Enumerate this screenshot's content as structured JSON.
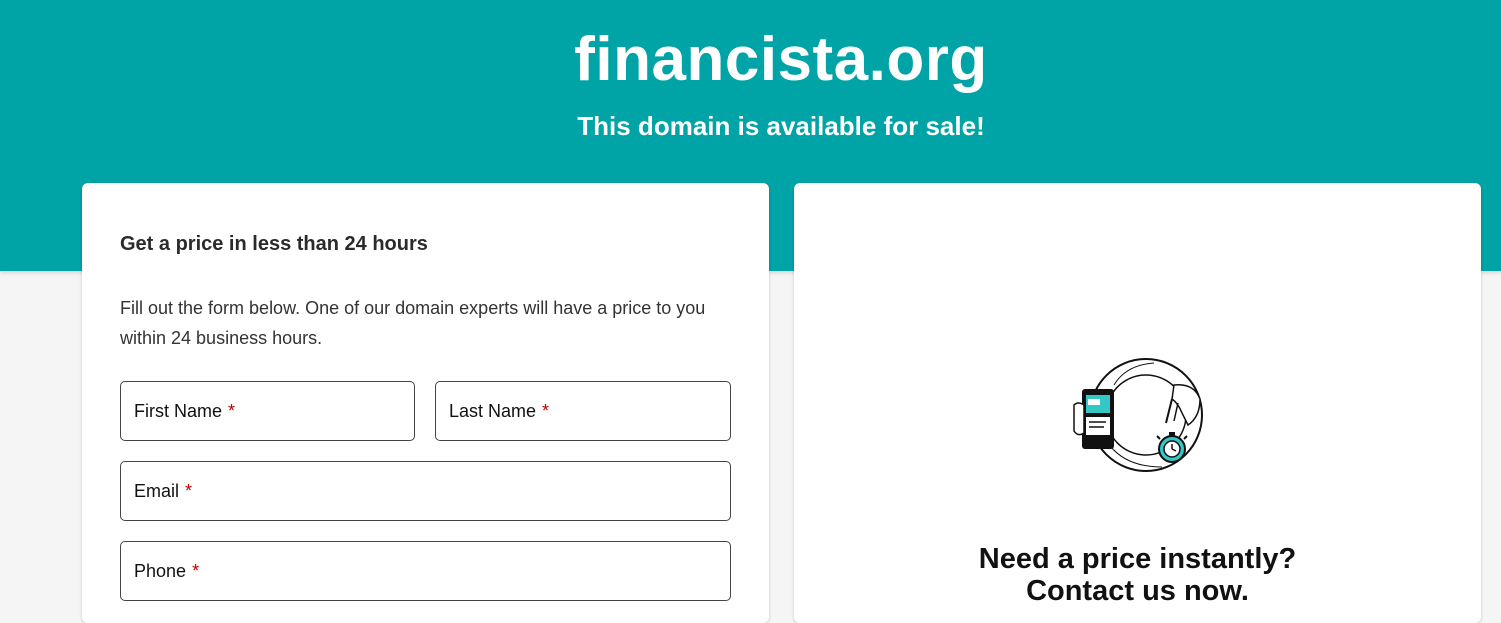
{
  "hero": {
    "domain": "financista.org",
    "subtitle": "This domain is available for sale!"
  },
  "form": {
    "title": "Get a price in less than 24 hours",
    "description": "Fill out the form below. One of our domain experts will have a price to you within 24 business hours.",
    "fields": {
      "first_name": "First Name",
      "last_name": "Last Name",
      "email": "Email",
      "phone": "Phone",
      "required_mark": "*"
    }
  },
  "contact": {
    "headline_line1": "Need a price instantly?",
    "headline_line2": "Contact us now."
  },
  "colors": {
    "hero_background": "#00a4a6",
    "accent_teal": "#35c6c6",
    "required": "#c00000"
  },
  "icons": [
    "phone-hand-icon",
    "pointing-hand-icon",
    "stopwatch-icon"
  ]
}
